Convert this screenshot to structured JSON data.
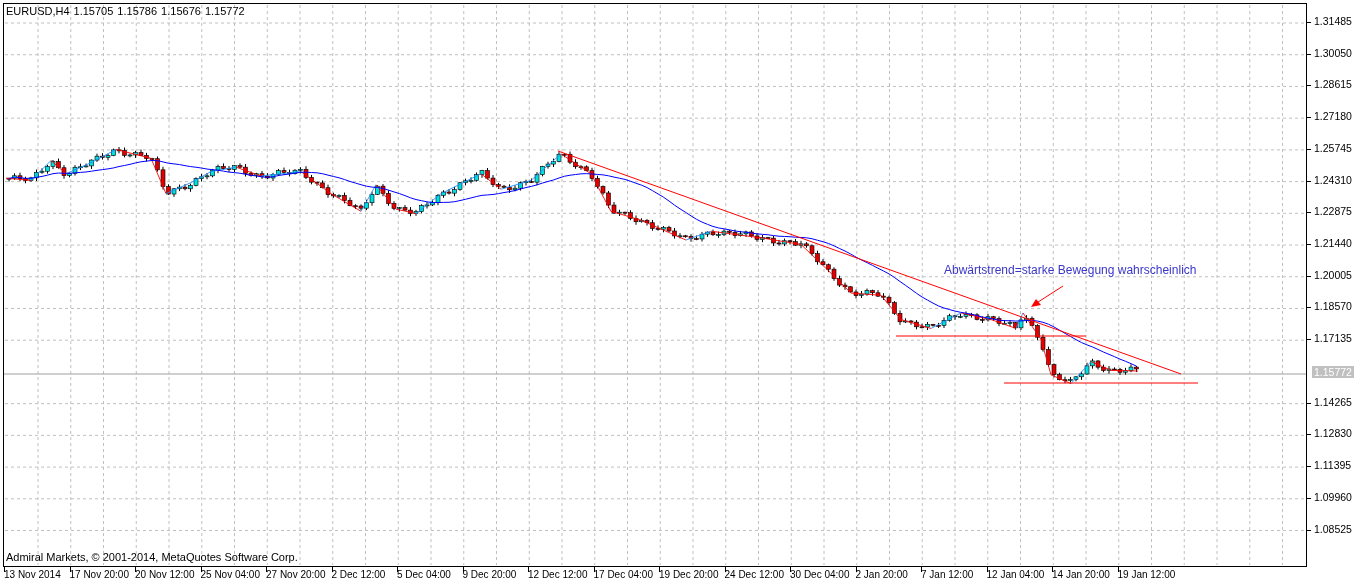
{
  "chart_header": {
    "symbol": "EURUSD,H4",
    "prices": [
      "1.15705",
      "1.15786",
      "1.15676",
      "1.15772"
    ]
  },
  "annotation": "Abwärtstrend=starke Bewegung wahrscheinlich",
  "copyright": "Admiral Markets, © 2001-2014, MetaQuotes Software Corp.",
  "price_axis": {
    "labels": [
      "1.31485",
      "1.30050",
      "1.28615",
      "1.27180",
      "1.25745",
      "1.24310",
      "1.22875",
      "1.21440",
      "1.20005",
      "1.18570",
      "1.17135",
      "1.14265",
      "1.12830",
      "1.11395",
      "1.09960",
      "1.08525"
    ],
    "current_price": "1.15772"
  },
  "time_axis": {
    "labels": [
      "13 Nov 2014",
      "17 Nov 20:00",
      "20 Nov 12:00",
      "25 Nov 04:00",
      "27 Nov 20:00",
      "2 Dec 12:00",
      "5 Dec 04:00",
      "9 Dec 20:00",
      "12 Dec 12:00",
      "17 Dec 04:00",
      "19 Dec 20:00",
      "24 Dec 12:00",
      "30 Dec 04:00",
      "2 Jan 20:00",
      "7 Jan 12:00",
      "12 Jan 04:00",
      "14 Jan 20:00",
      "19 Jan 12:00"
    ]
  }
}
